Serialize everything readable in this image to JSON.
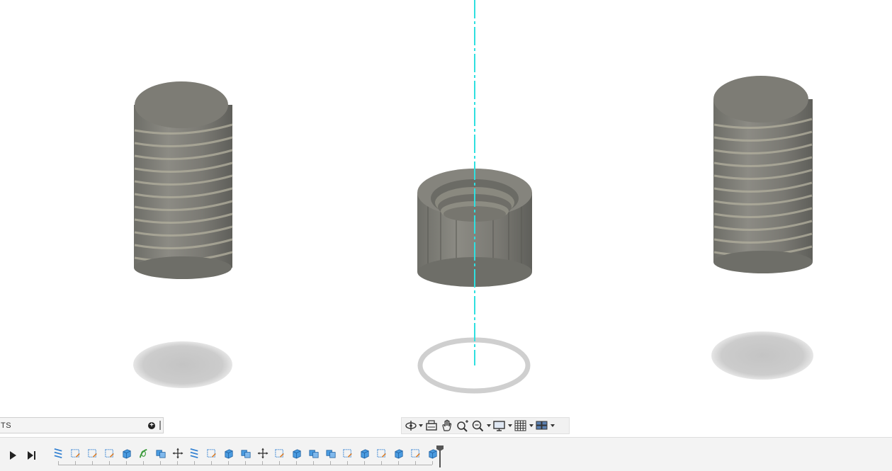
{
  "viewport": {
    "accent_axis_color": "#2fe0e0",
    "part_color": "#8a8a82"
  },
  "comments_panel": {
    "label": "TS",
    "add_icon": "plus-circle-icon"
  },
  "nav_toolbar": {
    "items": [
      {
        "name": "orbit-icon",
        "has_dropdown": true
      },
      {
        "name": "look-at-icon",
        "has_dropdown": false
      },
      {
        "name": "pan-icon",
        "has_dropdown": false
      },
      {
        "name": "zoom-icon",
        "has_dropdown": false
      },
      {
        "name": "fit-icon",
        "has_dropdown": true
      },
      {
        "name": "display-settings-icon",
        "has_dropdown": true
      },
      {
        "name": "grid-snaps-icon",
        "has_dropdown": true
      },
      {
        "name": "viewports-icon",
        "has_dropdown": true
      }
    ]
  },
  "timeline": {
    "play_icon": "play-icon",
    "end_icon": "skip-to-end-icon",
    "features": [
      "thread-icon",
      "sketch-icon",
      "sketch-icon",
      "sketch-icon",
      "extrude-icon",
      "sweep-icon",
      "combine-icon",
      "move-icon",
      "thread-icon",
      "sketch-icon",
      "extrude-icon",
      "combine-icon",
      "move-icon",
      "sketch-icon",
      "extrude-icon",
      "combine-icon",
      "combine-icon",
      "sketch-icon",
      "extrude-icon",
      "sketch-icon",
      "extrude-icon",
      "sketch-icon",
      "extrude-icon"
    ]
  }
}
